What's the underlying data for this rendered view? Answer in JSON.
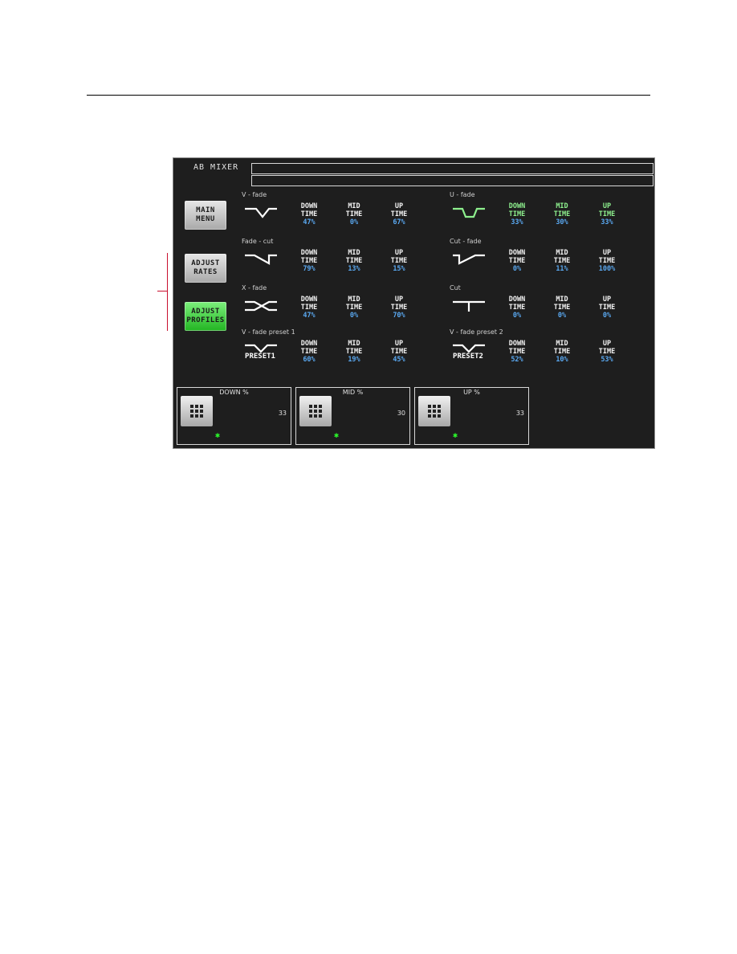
{
  "window": {
    "title": "AB MIXER"
  },
  "sidebar": {
    "buttons": [
      {
        "label_line1": "MAIN",
        "label_line2": "MENU",
        "active": false
      },
      {
        "label_line1": "ADJUST",
        "label_line2": "RATES",
        "active": false
      },
      {
        "label_line1": "ADJUST",
        "label_line2": "PROFILES",
        "active": true
      }
    ]
  },
  "column_labels": {
    "down": [
      "DOWN",
      "TIME"
    ],
    "mid": [
      "MID",
      "TIME"
    ],
    "up": [
      "UP",
      "TIME"
    ]
  },
  "profiles": [
    {
      "name": "V - fade",
      "icon": "v-fade-curve-icon",
      "down": "47%",
      "mid": "0%",
      "up": "67%",
      "active": false
    },
    {
      "name": "U - fade",
      "icon": "u-fade-curve-icon",
      "down": "33%",
      "mid": "30%",
      "up": "33%",
      "active": true
    },
    {
      "name": "Fade - cut",
      "icon": "fade-cut-curve-icon",
      "down": "79%",
      "mid": "13%",
      "up": "15%",
      "active": false
    },
    {
      "name": "Cut - fade",
      "icon": "cut-fade-curve-icon",
      "down": "0%",
      "mid": "11%",
      "up": "100%",
      "active": false
    },
    {
      "name": "X - fade",
      "icon": "x-fade-curve-icon",
      "down": "47%",
      "mid": "0%",
      "up": "70%",
      "active": false
    },
    {
      "name": "Cut",
      "icon": "cut-curve-icon",
      "down": "0%",
      "mid": "0%",
      "up": "0%",
      "active": false
    },
    {
      "name": "V - fade preset 1",
      "icon": "v-fade-preset-curve-icon",
      "preset_label": "PRESET1",
      "down": "60%",
      "mid": "19%",
      "up": "45%",
      "active": false
    },
    {
      "name": "V - fade preset 2",
      "icon": "v-fade-preset-curve-icon",
      "preset_label": "PRESET2",
      "down": "52%",
      "mid": "10%",
      "up": "53%",
      "active": false
    }
  ],
  "keypads": [
    {
      "label": "DOWN %",
      "value": "33",
      "icon": "keypad-icon",
      "led": "✱"
    },
    {
      "label": "MID %",
      "value": "30",
      "icon": "keypad-icon",
      "led": "✱"
    },
    {
      "label": "UP %",
      "value": "33",
      "icon": "keypad-icon",
      "led": "✱"
    }
  ],
  "colors": {
    "panel_bg": "#1e1e1e",
    "value_blue": "#5aa8f0",
    "active_green": "#8ef08e",
    "led_green": "#2bff2b",
    "annotation_red": "#c8102e"
  }
}
